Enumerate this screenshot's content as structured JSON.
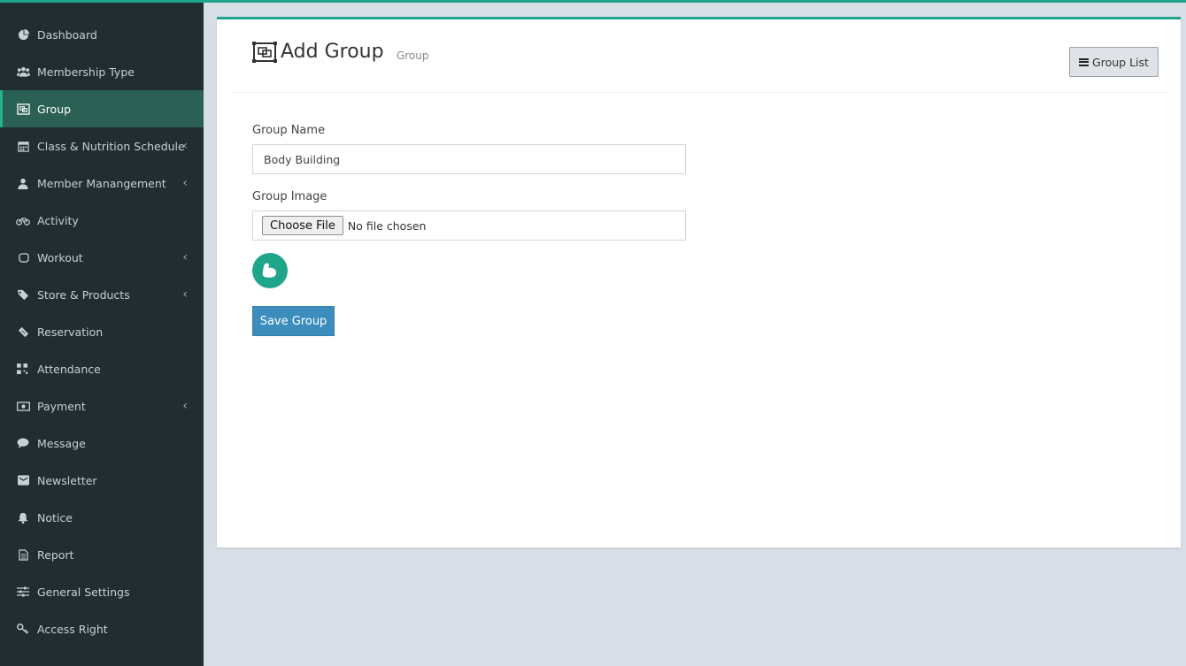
{
  "sidebar": {
    "items": [
      {
        "label": "Dashboard",
        "icon": "dashboard-icon",
        "has_submenu": false
      },
      {
        "label": "Membership Type",
        "icon": "users-icon",
        "has_submenu": false
      },
      {
        "label": "Group",
        "icon": "group-icon",
        "has_submenu": false,
        "active": true
      },
      {
        "label": "Class & Nutrition Schedule",
        "icon": "calendar-icon",
        "has_submenu": true
      },
      {
        "label": "Member Manangement",
        "icon": "user-icon",
        "has_submenu": true
      },
      {
        "label": "Activity",
        "icon": "bicycle-icon",
        "has_submenu": false
      },
      {
        "label": "Workout",
        "icon": "fist-icon",
        "has_submenu": true
      },
      {
        "label": "Store & Products",
        "icon": "tags-icon",
        "has_submenu": true
      },
      {
        "label": "Reservation",
        "icon": "ticket-icon",
        "has_submenu": false
      },
      {
        "label": "Attendance",
        "icon": "qrcode-icon",
        "has_submenu": false
      },
      {
        "label": "Payment",
        "icon": "money-icon",
        "has_submenu": true
      },
      {
        "label": "Message",
        "icon": "comment-icon",
        "has_submenu": false
      },
      {
        "label": "Newsletter",
        "icon": "envelope-icon",
        "has_submenu": false
      },
      {
        "label": "Notice",
        "icon": "bell-icon",
        "has_submenu": false
      },
      {
        "label": "Report",
        "icon": "file-icon",
        "has_submenu": false
      },
      {
        "label": "General Settings",
        "icon": "sliders-icon",
        "has_submenu": false
      },
      {
        "label": "Access Right",
        "icon": "key-icon",
        "has_submenu": false
      }
    ]
  },
  "header": {
    "title": "Add Group",
    "subtitle": "Group",
    "list_button_label": "Group List"
  },
  "form": {
    "group_name_label": "Group Name",
    "group_name_value": "Body Building",
    "group_image_label": "Group Image",
    "choose_file_label": "Choose File",
    "file_status": "No file chosen",
    "save_label": "Save Group"
  },
  "colors": {
    "accent": "#1fa58a",
    "sidebar_bg": "#222d32",
    "sidebar_active_bg": "#2b6055",
    "primary_button": "#3c8dbc"
  }
}
